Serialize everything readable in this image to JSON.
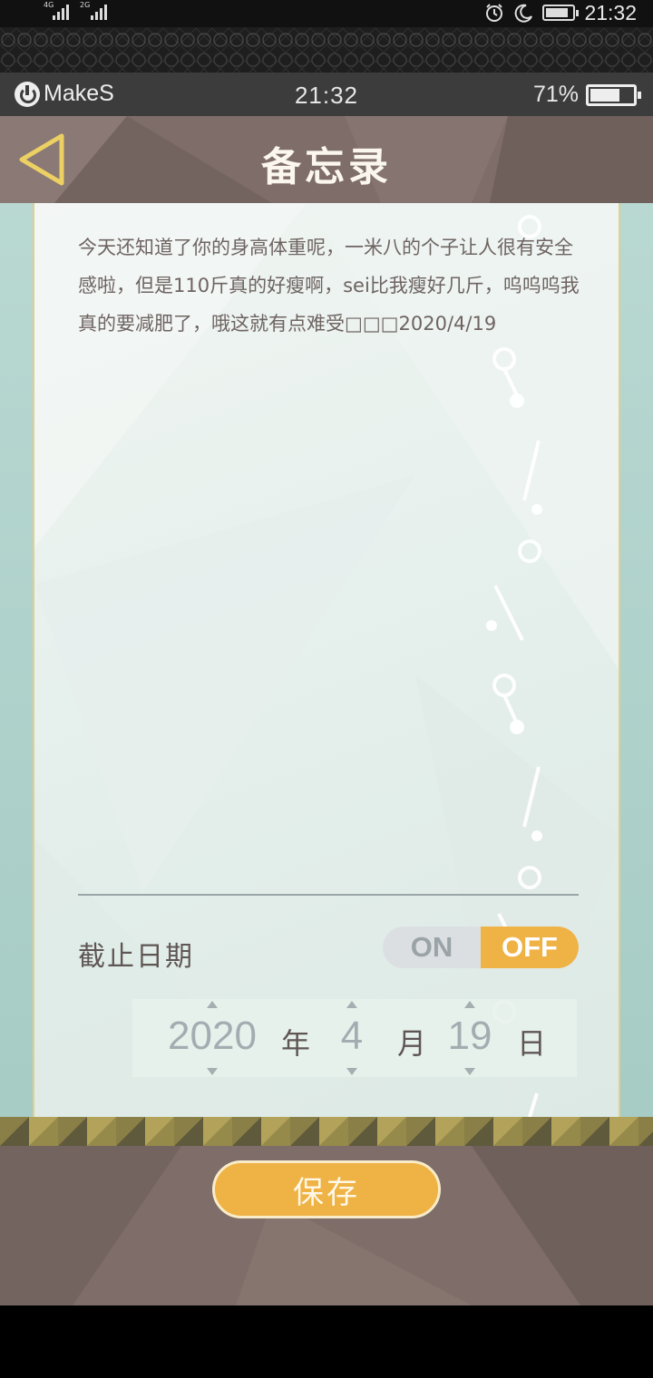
{
  "system_bar": {
    "network_1": "4G",
    "network_2": "2G",
    "time": "21:32",
    "battery_fill": 0.85
  },
  "app_status": {
    "brand": "MakeS",
    "time": "21:32",
    "battery_percent": "71%",
    "battery_fill": 0.71
  },
  "header": {
    "title": "备忘录",
    "back_icon": "back-triangle-icon",
    "accent_color": "#ecd064"
  },
  "note": {
    "text": "今天还知道了你的身高体重呢，一米八的个子让人很有安全感啦，但是110斤真的好瘦啊，sei比我瘦好几斤，呜呜呜我真的要减肥了，哦这就有点难受□□□2020/4/19"
  },
  "deadline": {
    "label": "截止日期",
    "toggle_on": "ON",
    "toggle_off": "OFF",
    "selected": "OFF"
  },
  "date_picker": {
    "year": "2020",
    "year_unit": "年",
    "month": "4",
    "month_unit": "月",
    "day": "19",
    "day_unit": "日"
  },
  "footer": {
    "save_label": "保存"
  },
  "colors": {
    "header_bg": "#7e6d68",
    "accent": "#efb244",
    "paper": "#eaf2ef"
  }
}
